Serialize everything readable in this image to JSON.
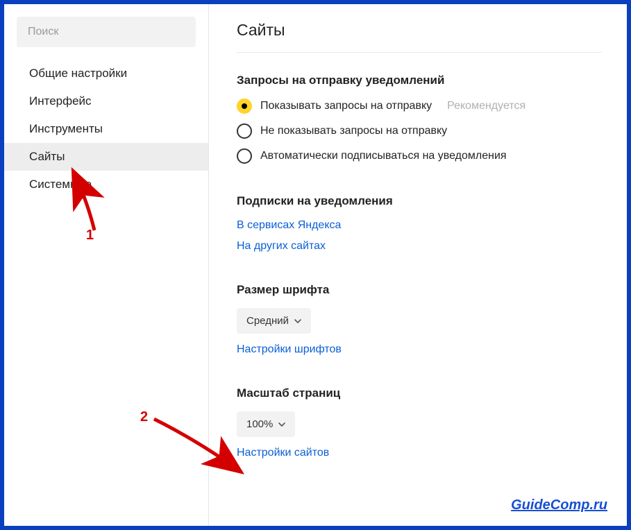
{
  "sidebar": {
    "search_placeholder": "Поиск",
    "items": [
      {
        "label": "Общие настройки",
        "active": false
      },
      {
        "label": "Интерфейс",
        "active": false
      },
      {
        "label": "Инструменты",
        "active": false
      },
      {
        "label": "Сайты",
        "active": true
      },
      {
        "label": "Системные",
        "active": false
      }
    ]
  },
  "page": {
    "title": "Сайты"
  },
  "notifications": {
    "title": "Запросы на отправку уведомлений",
    "options": [
      {
        "label": "Показывать запросы на отправку",
        "checked": true,
        "hint": "Рекомендуется"
      },
      {
        "label": "Не показывать запросы на отправку",
        "checked": false
      },
      {
        "label": "Автоматически подписываться на уведомления",
        "checked": false
      }
    ]
  },
  "subscriptions": {
    "title": "Подписки на уведомления",
    "link_yandex": "В сервисах Яндекса",
    "link_other": "На других сайтах"
  },
  "font": {
    "title": "Размер шрифта",
    "value": "Средний",
    "settings_link": "Настройки шрифтов"
  },
  "scale": {
    "title": "Масштаб страниц",
    "value": "100%",
    "settings_link": "Настройки сайтов"
  },
  "annotations": {
    "num1": "1",
    "num2": "2"
  },
  "watermark": "GuideComp.ru"
}
